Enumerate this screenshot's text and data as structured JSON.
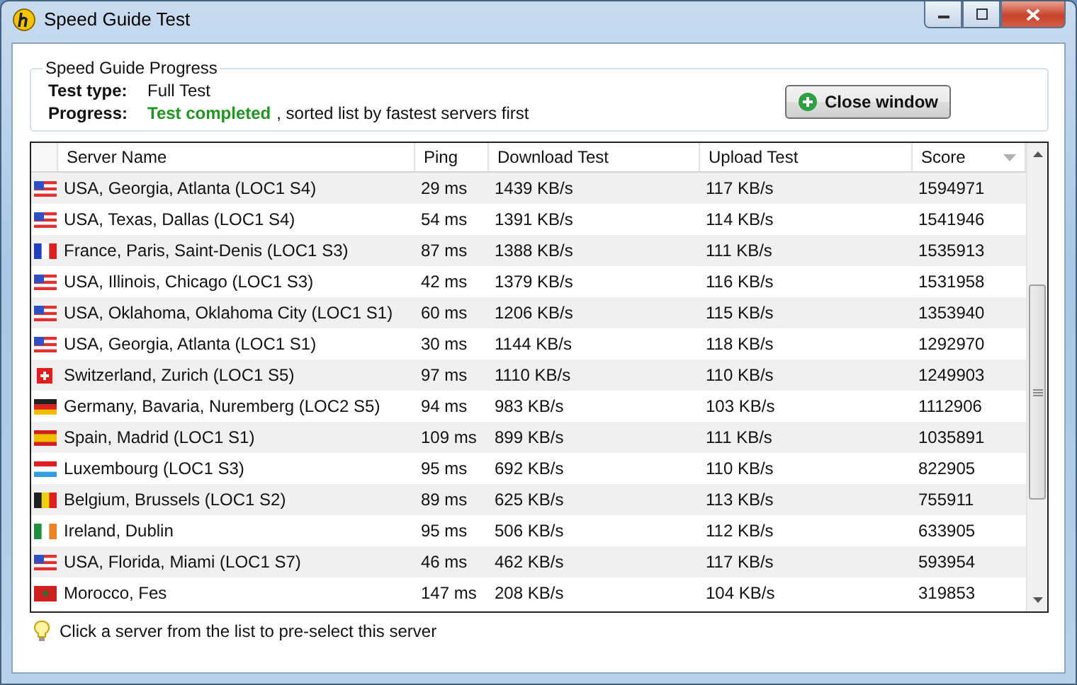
{
  "window": {
    "title": "Speed Guide Test"
  },
  "progress_group": {
    "title": "Speed Guide Progress",
    "test_type_label": "Test type:",
    "test_type": "Full Test",
    "progress_label": "Progress:",
    "status": "Test completed",
    "status_rest": ", sorted list by fastest servers first"
  },
  "close_button": {
    "label": "Close window"
  },
  "table": {
    "columns": [
      {
        "label": "Server Name",
        "sorted": false
      },
      {
        "label": "Ping",
        "sorted": false
      },
      {
        "label": "Download Test",
        "sorted": false
      },
      {
        "label": "Upload Test",
        "sorted": false
      },
      {
        "label": "Score",
        "sorted": true
      }
    ],
    "rows": [
      {
        "kind": "us",
        "server": "USA, Georgia, Atlanta (LOC1 S4)",
        "ping": "29 ms",
        "download": "1439 KB/s",
        "upload": "117 KB/s",
        "score": "1594971"
      },
      {
        "kind": "us",
        "server": "USA, Texas, Dallas (LOC1 S4)",
        "ping": "54 ms",
        "download": "1391 KB/s",
        "upload": "114 KB/s",
        "score": "1541946"
      },
      {
        "kind": "fr",
        "server": "France, Paris, Saint-Denis (LOC1 S3)",
        "ping": "87 ms",
        "download": "1388 KB/s",
        "upload": "111 KB/s",
        "score": "1535913"
      },
      {
        "kind": "us",
        "server": "USA, Illinois, Chicago (LOC1 S3)",
        "ping": "42 ms",
        "download": "1379 KB/s",
        "upload": "116 KB/s",
        "score": "1531958"
      },
      {
        "kind": "us",
        "server": "USA, Oklahoma, Oklahoma City (LOC1 S1)",
        "ping": "60 ms",
        "download": "1206 KB/s",
        "upload": "115 KB/s",
        "score": "1353940"
      },
      {
        "kind": "us",
        "server": "USA, Georgia, Atlanta (LOC1 S1)",
        "ping": "30 ms",
        "download": "1144 KB/s",
        "upload": "118 KB/s",
        "score": "1292970"
      },
      {
        "kind": "ch",
        "server": "Switzerland, Zurich (LOC1 S5)",
        "ping": "97 ms",
        "download": "1110 KB/s",
        "upload": "110 KB/s",
        "score": "1249903"
      },
      {
        "kind": "de",
        "server": "Germany, Bavaria, Nuremberg (LOC2 S5)",
        "ping": "94 ms",
        "download": "983 KB/s",
        "upload": "103 KB/s",
        "score": "1112906"
      },
      {
        "kind": "es",
        "server": "Spain, Madrid (LOC1 S1)",
        "ping": "109 ms",
        "download": "899 KB/s",
        "upload": "111 KB/s",
        "score": "1035891"
      },
      {
        "kind": "lu",
        "server": "Luxembourg (LOC1 S3)",
        "ping": "95 ms",
        "download": "692 KB/s",
        "upload": "110 KB/s",
        "score": "822905"
      },
      {
        "kind": "be",
        "server": "Belgium, Brussels (LOC1 S2)",
        "ping": "89 ms",
        "download": "625 KB/s",
        "upload": "113 KB/s",
        "score": "755911"
      },
      {
        "kind": "ie",
        "server": "Ireland, Dublin",
        "ping": "95 ms",
        "download": "506 KB/s",
        "upload": "112 KB/s",
        "score": "633905"
      },
      {
        "kind": "us",
        "server": "USA, Florida, Miami (LOC1 S7)",
        "ping": "46 ms",
        "download": "462 KB/s",
        "upload": "117 KB/s",
        "score": "593954"
      },
      {
        "kind": "ma",
        "server": "Morocco, Fes",
        "ping": "147 ms",
        "download": "208 KB/s",
        "upload": "104 KB/s",
        "score": "319853"
      }
    ]
  },
  "hint": "Click a server from the list to pre-select this server"
}
